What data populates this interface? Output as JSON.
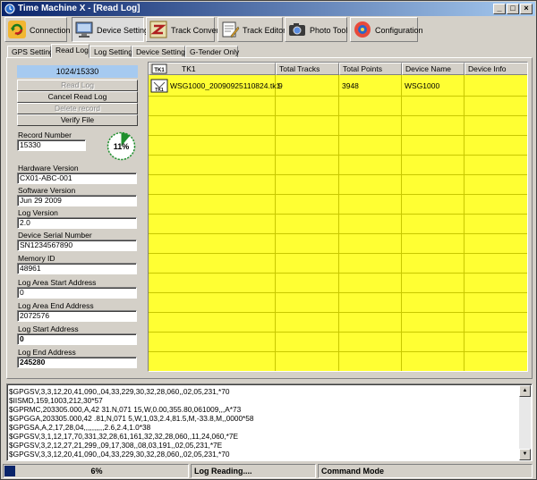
{
  "window": {
    "title": "Time Machine X - [Read Log]"
  },
  "toolbar": {
    "buttons": [
      {
        "label": "Connection",
        "icon": "refresh-icon"
      },
      {
        "label": "Device Setting",
        "icon": "monitor-icon"
      },
      {
        "label": "Track Convert",
        "icon": "convert-icon"
      },
      {
        "label": "Track Editor",
        "icon": "editor-icon"
      },
      {
        "label": "Photo Tool",
        "icon": "camera-icon"
      },
      {
        "label": "Configuration",
        "icon": "configuration-icon"
      }
    ]
  },
  "tabs": [
    "GPS Setting",
    "Read Log",
    "Log Setting",
    "Device Settings",
    "G-Tender Only"
  ],
  "left_panel": {
    "counter": "1024/15330",
    "buttons": {
      "read_log": "Read Log",
      "cancel_read_log": "Cancel Read Log",
      "delete_record": "Delete record",
      "verify_file": "Verify File"
    },
    "progress_percent_label": "11%",
    "progress_fraction": 0.11,
    "fields": {
      "record_number": {
        "label": "Record Number",
        "value": "15330"
      },
      "hardware_version": {
        "label": "Hardware Version",
        "value": "CX01-ABC-001"
      },
      "software_version": {
        "label": "Software Version",
        "value": "Jun 29 2009"
      },
      "log_version": {
        "label": "Log Version",
        "value": "2.0"
      },
      "device_serial_number": {
        "label": "Device Serial Number",
        "value": "SN1234567890"
      },
      "memory_id": {
        "label": "Memory ID",
        "value": "48961"
      },
      "log_area_start_address": {
        "label": "Log Area Start Address",
        "value": "0"
      },
      "log_area_end_address": {
        "label": "Log Area End Address",
        "value": "2072576"
      },
      "log_start_address": {
        "label": "Log Start Address",
        "value": "0"
      },
      "log_end_address": {
        "label": "Log End Address",
        "value": "245280"
      }
    }
  },
  "table": {
    "columns": [
      "TK1",
      "Total Tracks",
      "Total Points",
      "Device Name",
      "Device Info"
    ],
    "rows": [
      {
        "file": "WSG1000_20090925110824.tk1",
        "total_tracks": "9",
        "total_points": "3948",
        "device_name": "WSG1000",
        "device_info": ""
      }
    ],
    "background_color": "#ffff33"
  },
  "log_lines": [
    "$GPGSV,3,3,12,20,41,090,,04,33,229,30,32,28,060,,02,05,231,*70",
    "$IISMD,159,1003,212,30*57",
    "$GPRMC,203305.000,A,42          31.N,071          15,W,0.00,355.80,061009,,,A*73",
    "$GPGGA,203305.000,42          .81,N,071          5,W,1,03,2.4,81.5,M,-33.8,M,,0000*58",
    "$GPGSA,A,2,17,28,04,,,,,,,,,,2.6,2.4,1.0*38",
    "$GPGSV,3,1,12,17,70,331,32,28,61,161,32,32,28,060,,11,24,060,*7E",
    "$GPGSV,3,2,12,27,21,299,,09,17,308,,08,03,191,,02,05,231,*7E",
    "$GPGSV,3,3,12,20,41,090,,04,33,229,30,32,28,060,,02,05,231,*70"
  ],
  "status": {
    "progress_label": "6%",
    "progress_fraction": 0.06,
    "message": "Log Reading....",
    "mode": "Command Mode"
  }
}
